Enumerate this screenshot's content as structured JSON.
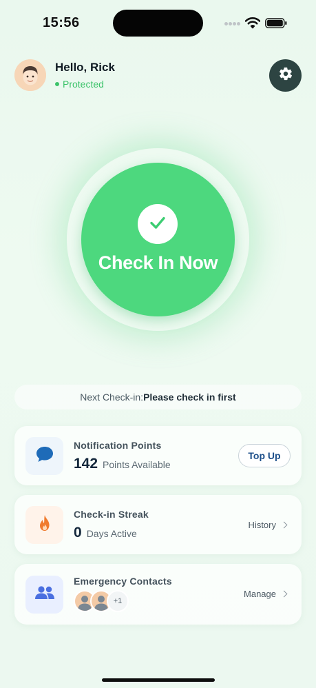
{
  "status_bar": {
    "time": "15:56"
  },
  "header": {
    "greeting": "Hello, Rick",
    "status": "Protected"
  },
  "check_in": {
    "label": "Check In Now"
  },
  "next_check_in": {
    "label": "Next Check-in:",
    "value": "Please check in first"
  },
  "cards": {
    "notification_points": {
      "title": "Notification Points",
      "value": "142",
      "unit": "Points Available",
      "action": "Top Up"
    },
    "streak": {
      "title": "Check-in Streak",
      "value": "0",
      "unit": "Days Active",
      "action": "History"
    },
    "emergency_contacts": {
      "title": "Emergency Contacts",
      "more": "+1",
      "action": "Manage"
    }
  },
  "icons": {
    "settings": "gear-icon",
    "check": "checkmark-icon",
    "notification": "chat-bubble-icon",
    "streak": "flame-icon",
    "contacts": "people-icon"
  },
  "colors": {
    "accent_green": "#4dd87e",
    "protected_green": "#3cc36a",
    "settings_bg": "#2d4442",
    "topup_text": "#1d4f8a",
    "streak_flame": "#f07a2d",
    "contacts_icon": "#4a6fe0",
    "chat_icon": "#1e6bb8"
  }
}
